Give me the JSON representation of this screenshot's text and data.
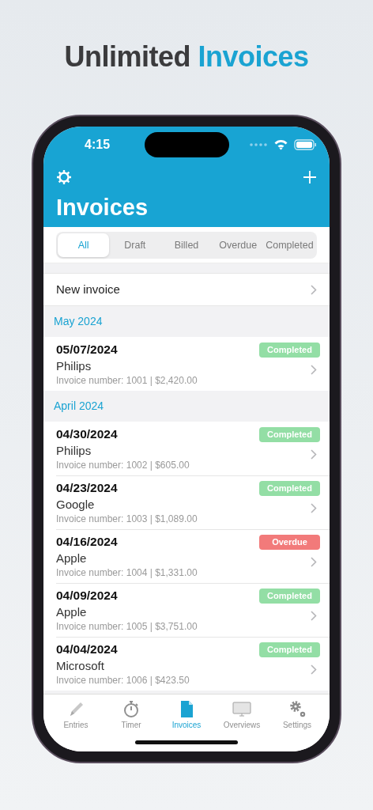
{
  "headline": [
    {
      "text": "Unlimited",
      "accent": false
    },
    {
      "text": "Invoices",
      "accent": true
    }
  ],
  "status_bar": {
    "time": "4:15"
  },
  "header": {
    "title": "Invoices"
  },
  "filter_tabs": [
    {
      "label": "All",
      "selected": true
    },
    {
      "label": "Draft",
      "selected": false
    },
    {
      "label": "Billed",
      "selected": false
    },
    {
      "label": "Overdue",
      "selected": false
    },
    {
      "label": "Completed",
      "selected": false
    }
  ],
  "new_invoice": {
    "label": "New invoice"
  },
  "sections": [
    {
      "title": "May 2024",
      "invoices": [
        {
          "date": "05/07/2024",
          "client": "Philips",
          "details": "Invoice number: 1001 | $2,420.00",
          "status": {
            "label": "Completed",
            "kind": "completed"
          }
        }
      ]
    },
    {
      "title": "April 2024",
      "invoices": [
        {
          "date": "04/30/2024",
          "client": "Philips",
          "details": "Invoice number: 1002 | $605.00",
          "status": {
            "label": "Completed",
            "kind": "completed"
          }
        },
        {
          "date": "04/23/2024",
          "client": "Google",
          "details": "Invoice number: 1003 | $1,089.00",
          "status": {
            "label": "Completed",
            "kind": "completed"
          }
        },
        {
          "date": "04/16/2024",
          "client": "Apple",
          "details": "Invoice number: 1004 | $1,331.00",
          "status": {
            "label": "Overdue",
            "kind": "overdue"
          }
        },
        {
          "date": "04/09/2024",
          "client": "Apple",
          "details": "Invoice number: 1005 | $3,751.00",
          "status": {
            "label": "Completed",
            "kind": "completed"
          }
        },
        {
          "date": "04/04/2024",
          "client": "Microsoft",
          "details": "Invoice number: 1006 | $423.50",
          "status": {
            "label": "Completed",
            "kind": "completed"
          }
        }
      ]
    }
  ],
  "tab_bar": [
    {
      "label": "Entries",
      "kind": "pencil",
      "selected": false
    },
    {
      "label": "Timer",
      "kind": "stopwatch",
      "selected": false
    },
    {
      "label": "Invoices",
      "kind": "document",
      "selected": true
    },
    {
      "label": "Overviews",
      "kind": "monitor",
      "selected": false
    },
    {
      "label": "Settings",
      "kind": "gears",
      "selected": false
    }
  ]
}
